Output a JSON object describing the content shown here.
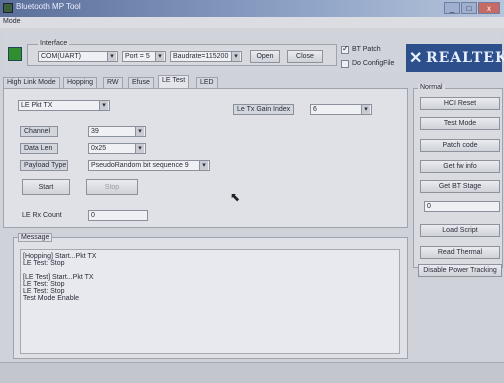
{
  "window": {
    "title": "Bluetooth MP Tool",
    "controls": [
      "_",
      "□",
      "x"
    ]
  },
  "menu": {
    "mode": "Mode"
  },
  "interface_group": {
    "caption": "Interface",
    "port_value": "COM(UART)",
    "port_num_value": "Port = 5",
    "baud_value": "Baudrate=115200",
    "open_label": "Open",
    "close_label": "Close",
    "bt_patch_label": "BT Patch",
    "do_config_label": "Do ConfigFile",
    "bt_patch_checked": true,
    "do_config_checked": false
  },
  "logo": {
    "text": "REALTEK"
  },
  "tabs": [
    "High Link Mode",
    "Hopping",
    "RW",
    "Efuse",
    "LE Test",
    "LED"
  ],
  "active_tab_index": 4,
  "le_test": {
    "mode_value": "LE Pkt TX",
    "tx_gain_index_label": "Le Tx Gain Index",
    "tx_gain_index_value": "6",
    "channel_label": "Channel",
    "channel_value": "39",
    "data_len_label": "Data Len",
    "data_len_value": "0x25",
    "payload_type_label": "Payload Type",
    "payload_type_value": "PseudoRandom bit sequence 9",
    "start_label": "Start",
    "stop_label": "Stop",
    "rx_pkt_count_label": "LE Rx Count",
    "rx_pkt_count_value": "0"
  },
  "message": {
    "caption": "Message",
    "lines": [
      "[Hopping] Start...Pkt TX",
      "LE Test: Stop",
      "",
      "[LE Test] Start...Pkt TX",
      "LE Test: Stop",
      "LE Test: Stop",
      "Test Mode Enable"
    ]
  },
  "right_panel": {
    "caption": "Normal",
    "hci_reset_label": "HCI Reset",
    "test_mode_label": "Test Mode",
    "patch_code_label": "Patch code",
    "get_fw_info_label": "Get fw info",
    "get_bt_stage_label": "Get BT Stage",
    "stage_value": "0",
    "load_script_label": "Load Script",
    "read_thermal_label": "Read Thermal",
    "disable_power_tracking_label": "Disable Power Tracking"
  }
}
